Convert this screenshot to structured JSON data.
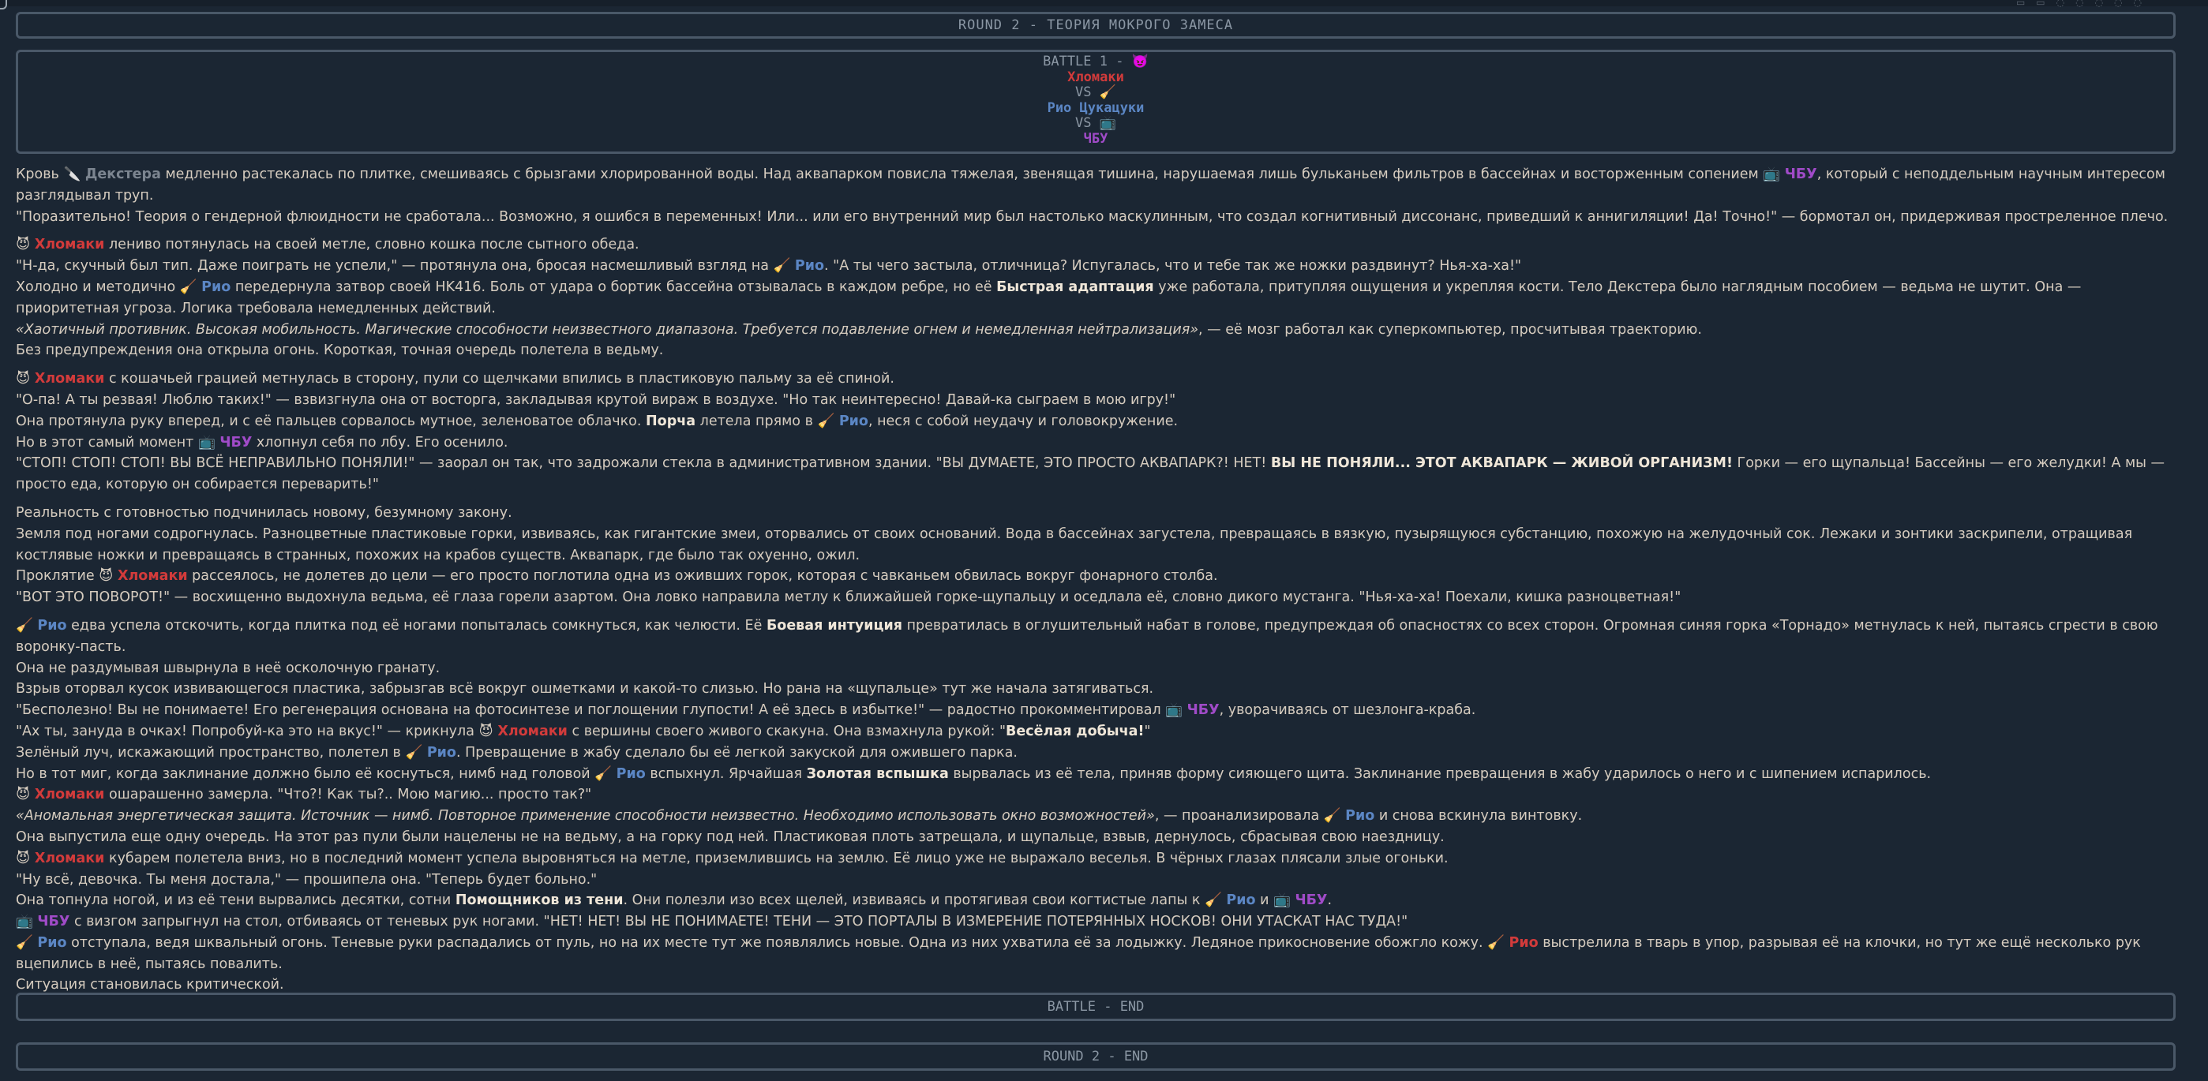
{
  "header": {
    "round_title": "ROUND 2 - ТЕОРИЯ МОКРОГО ЗАМЕСА",
    "battle_label": "BATTLE 1 -",
    "vs": "VS",
    "fighters": [
      {
        "name": "Хломаки",
        "icon": "devil-face-icon"
      },
      {
        "name": "Рио Цукацуки",
        "icon": "broom-icon"
      },
      {
        "name": "ЧБУ",
        "icon": "tv-icon"
      }
    ]
  },
  "names": {
    "khlomaki": "Хломаки",
    "rio": "Рио",
    "chbu": "ЧБУ",
    "dexter": "Декстера"
  },
  "icons": {
    "devil": "😈",
    "broom": "🧹",
    "tv": "📺",
    "knife": "🔪"
  },
  "colors": {
    "background": "#1b2633",
    "frame": "#4a5868",
    "khlomaki": "#d23b3b",
    "rio": "#5b86c4",
    "chbu": "#a04bc8",
    "dexter": "#7c8590"
  },
  "footer": {
    "battle_end": "BATTLE - END",
    "round_end": "ROUND 2 - END"
  },
  "story": {
    "p1a": "Кровь",
    "p1b": "медленно растекалась по плитке, смешиваясь с брызгами хлорированной воды. Над аквапарком повисла тяжелая, звенящая тишина, нарушаемая лишь бульканьем фильтров в бассейнах и восторженным сопением",
    "p1c": ", который с неподдельным научным интересом разглядывал труп.",
    "p2": "\"Поразительно! Теория о гендерной флюидности не сработала... Возможно, я ошибся в переменных! Или... или его внутренний мир был настолько маскулинным, что создал когнитивный диссонанс, приведший к аннигиляции! Да! Точно!\" — бормотал он, придерживая простреленное плечо.",
    "p3": "лениво потянулась на своей метле, словно кошка после сытного обеда.",
    "p4a": "\"Н-да, скучный был тип. Даже поиграть не успели,\" — протянула она, бросая насмешливый взгляд на",
    "p4b": ". \"А ты чего застыла, отличница? Испугалась, что и тебе так же ножки раздвинут? Нья-ха-ха!\"",
    "p5a": "Холодно и методично",
    "p5b": "передернула затвор своей HK416. Боль от удара о бортик бассейна отзывалась в каждом ребре, но её",
    "p5bold": "Быстрая адаптация",
    "p5c": "уже работала, притупляя ощущения и укрепляя кости. Тело Декстера было наглядным пособием — ведьма не шутит. Она — приоритетная угроза. Логика требовала немедленных действий.",
    "p6i": "«Хаотичный противник. Высокая мобильность. Магические способности неизвестного диапазона. Требуется подавление огнем и немедленная нейтрализация»",
    "p6b": ", — её мозг работал как суперкомпьютер, просчитывая траекторию.",
    "p7": "Без предупреждения она открыла огонь. Короткая, точная очередь полетела в ведьму.",
    "p8": "с кошачьей грацией метнулась в сторону, пули со щелчками впились в пластиковую пальму за её спиной.",
    "p9": "\"О-па! А ты резвая! Люблю таких!\" — взвизгнула она от восторга, закладывая крутой вираж в воздухе. \"Но так неинтересно! Давай-ка сыграем в мою игру!\"",
    "p10a": "Она протянула руку вперед, и с её пальцев сорвалось мутное, зеленоватое облачко.",
    "p10bold": "Порча",
    "p10b": "летела прямо в",
    "p10c": ", неся с собой неудачу и головокружение.",
    "p11a": "Но в этот самый момент",
    "p11b": "хлопнул себя по лбу. Его осенило.",
    "p12a": "\"СТОП! СТОП! СТОП! ВЫ ВСЁ НЕПРАВИЛЬНО ПОНЯЛИ!\" — заорал он так, что задрожали стекла в административном здании. \"ВЫ ДУМАЕТЕ, ЭТО ПРОСТО АКВАПАРК?! НЕТ!",
    "p12bold": "ВЫ НЕ ПОНЯЛИ... ЭТОТ АКВАПАРК — ЖИВОЙ ОРГАНИЗМ!",
    "p12b": "Горки — его щупальца! Бассейны — его желудки! А мы — просто еда, которую он собирается переварить!\"",
    "p13": "Реальность с готовностью подчинилась новому, безумному закону.",
    "p14": "Земля под ногами содрогнулась. Разноцветные пластиковые горки, извиваясь, как гигантские змеи, оторвались от своих оснований. Вода в бассейнах загустела, превращаясь в вязкую, пузырящуюся субстанцию, похожую на желудочный сок. Лежаки и зонтики заскрипели, отращивая костлявые ножки и превращаясь в странных, похожих на крабов существ. Аквапарк, где было так охуенно, ожил.",
    "p15a": "Проклятие",
    "p15b": "рассеялось, не долетев до цели — его просто поглотила одна из оживших горок, которая с чавканьем обвилась вокруг фонарного столба.",
    "p16": "\"ВОТ ЭТО ПОВОРОТ!\" — восхищенно выдохнула ведьма, её глаза горели азартом. Она ловко направила метлу к ближайшей горке-щупальцу и оседлала её, словно дикого мустанга. \"Нья-ха-ха! Поехали, кишка разноцветная!\"",
    "p17a": "едва успела отскочить, когда плитка под её ногами попыталась сомкнуться, как челюсти. Её",
    "p17bold": "Боевая интуиция",
    "p17b": "превратилась в оглушительный набат в голове, предупреждая об опасностях со всех сторон. Огромная синяя горка «Торнадо» метнулась к ней, пытаясь сгрести в свою воронку-пасть.",
    "p18": "Она не раздумывая швырнула в неё осколочную гранату.",
    "p19": "Взрыв оторвал кусок извивающегося пластика, забрызгав всё вокруг ошметками и какой-то слизью. Но рана на «щупальце» тут же начала затягиваться.",
    "p20a": "\"Бесполезно! Вы не понимаете! Его регенерация основана на фотосинтезе и поглощении глупости! А её здесь в избытке!\" — радостно прокомментировал",
    "p20b": ", уворачиваясь от шезлонга-краба.",
    "p21a": "\"Ах ты, зануда в очках! Попробуй-ка это на вкус!\" — крикнула",
    "p21b": "с вершины своего живого скакуна. Она взмахнула рукой: \"",
    "p21bold": "Весёлая добыча!",
    "p21c": "\"",
    "p22a": "Зелёный луч, искажающий пространство, полетел в",
    "p22b": ". Превращение в жабу сделало бы её легкой закуской для ожившего парка.",
    "p23a": "Но в тот миг, когда заклинание должно было её коснуться, нимб над головой",
    "p23b": "вспыхнул. Ярчайшая",
    "p23bold": "Золотая вспышка",
    "p23c": "вырвалась из её тела, приняв форму сияющего щита. Заклинание превращения в жабу ударилось о него и с шипением испарилось.",
    "p24": "ошарашенно замерла. \"Что?! Как ты?.. Мою магию... просто так?\"",
    "p25i": "«Аномальная энергетическая защита. Источник — нимб. Повторное применение способности неизвестно. Необходимо использовать окно возможностей»",
    "p25b": ", — проанализировала",
    "p25c": "и снова вскинула винтовку.",
    "p26": "Она выпустила еще одну очередь. На этот раз пули были нацелены не на ведьму, а на горку под ней. Пластиковая плоть затрещала, и щупальце, взвыв, дернулось, сбрасывая свою наездницу.",
    "p27": "кубарем полетела вниз, но в последний момент успела выровняться на метле, приземлившись на землю. Её лицо уже не выражало веселья. В чёрных глазах плясали злые огоньки.",
    "p28": "\"Ну всё, девочка. Ты меня достала,\" — прошипела она. \"Теперь будет больно.\"",
    "p29a": "Она топнула ногой, и из её тени вырвались десятки, сотни",
    "p29bold": "Помощников из тени",
    "p29b": ". Они полезли изо всех щелей, извиваясь и протягивая свои когтистые лапы к",
    "p29and": "и",
    "p29end": ".",
    "p30": "с визгом запрыгнул на стол, отбиваясь от теневых рук ногами. \"НЕТ! НЕТ! ВЫ НЕ ПОНИМАЕТЕ! ТЕНИ — ЭТО ПОРТАЛЫ В ИЗМЕРЕНИЕ ПОТЕРЯННЫХ НОСКОВ! ОНИ УТАСКАТ НАС ТУДА!\"",
    "p31a": "отступала, ведя шквальный огонь. Теневые руки распадались от пуль, но на их месте тут же появлялись новые. Одна из них ухватила её за лодыжку. Ледяное прикосновение обожгло кожу.",
    "p31b": "выстрелила в тварь в упор, разрывая её на клочки, но тут же ещё несколько рук вцепились в неё, пытаясь повалить.",
    "p32": "Ситуация становилась критической."
  }
}
